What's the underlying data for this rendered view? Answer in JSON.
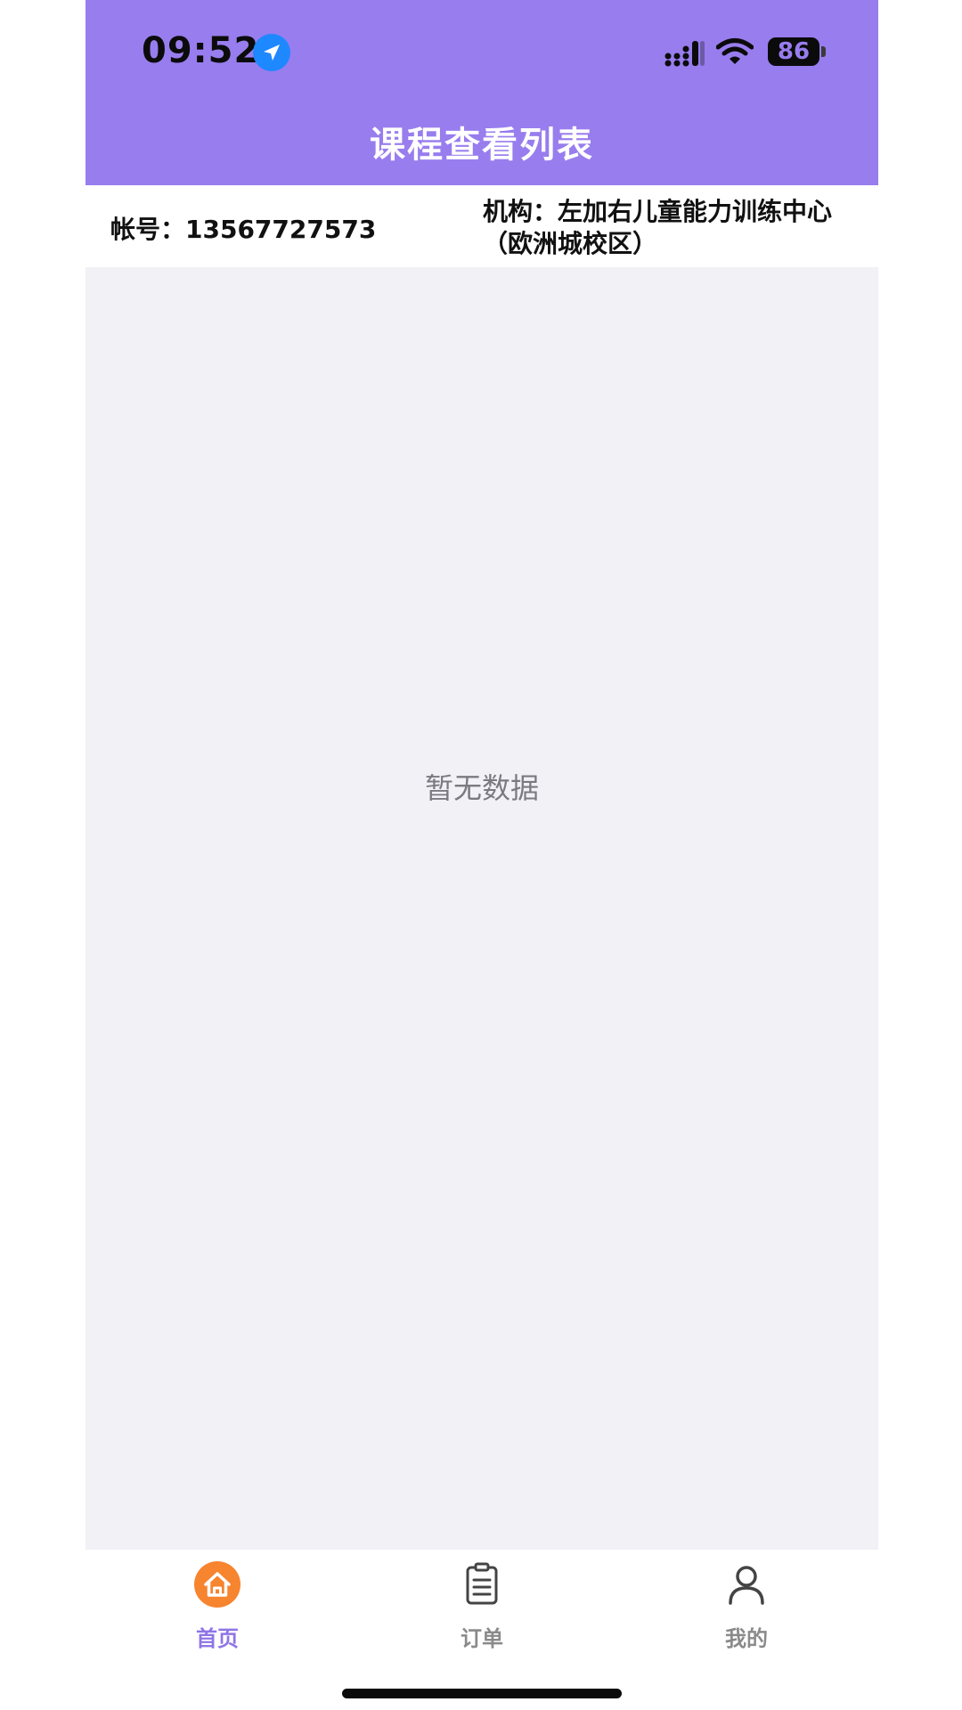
{
  "status_bar": {
    "time": "09:52",
    "battery": "86",
    "icons": [
      "location-icon",
      "signal-icon",
      "wifi-icon",
      "battery-icon"
    ]
  },
  "header": {
    "title": "课程查看列表",
    "background": "#987dee"
  },
  "info": {
    "account_label": "帐号：13567727573",
    "org_label": "机构：左加右儿童能力训练中心（欧洲城校区）"
  },
  "content": {
    "empty_text": "暂无数据",
    "background": "#f1f1f6"
  },
  "tabbar": {
    "tabs": [
      {
        "label": "首页",
        "icon": "home-icon",
        "active": true
      },
      {
        "label": "订单",
        "icon": "order-list-icon",
        "active": false
      },
      {
        "label": "我的",
        "icon": "user-icon",
        "active": false
      }
    ],
    "active_color": "#8f74e6",
    "home_icon_bg": "#f7842f"
  }
}
